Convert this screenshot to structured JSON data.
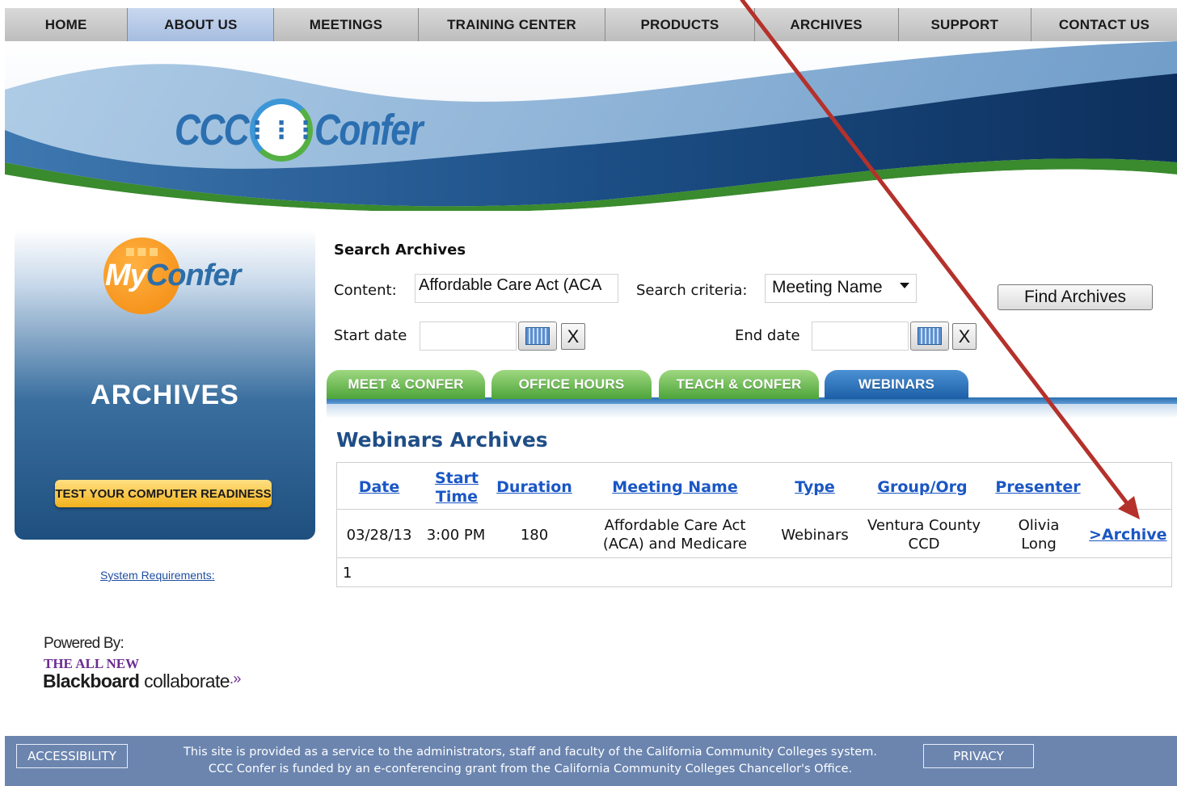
{
  "nav": {
    "items": [
      {
        "label": "HOME"
      },
      {
        "label": "ABOUT US",
        "active": true
      },
      {
        "label": "MEETINGS"
      },
      {
        "label": "TRAINING CENTER"
      },
      {
        "label": "PRODUCTS"
      },
      {
        "label": "ARCHIVES"
      },
      {
        "label": "SUPPORT"
      },
      {
        "label": "CONTACT US"
      }
    ]
  },
  "brand": {
    "logo_left": "CCC",
    "logo_right": "Confer",
    "logo_icon": "phone-keypad-icon"
  },
  "sidebar": {
    "myconfer_my": "My",
    "myconfer_confer": "Confer",
    "heading": "ARCHIVES",
    "readiness_button": "TEST YOUR COMPUTER READINESS",
    "system_requirements": "System Requirements:",
    "powered_by": "Powered By:",
    "all_new": "THE ALL NEW",
    "bb_bold": "Blackboard",
    "bb_rest": "collaborate",
    "bb_mark": ".»"
  },
  "search": {
    "title": "Search Archives",
    "content_label": "Content:",
    "content_value": "Affordable Care Act (ACA",
    "criteria_label": "Search criteria:",
    "criteria_value": "Meeting Name",
    "find_button": "Find Archives",
    "start_label": "Start date",
    "start_value": "",
    "end_label": "End date",
    "end_value": "",
    "clear_label": "X"
  },
  "tabs": [
    {
      "label": "MEET & CONFER",
      "color": "green"
    },
    {
      "label": "OFFICE HOURS",
      "color": "green"
    },
    {
      "label": "TEACH & CONFER",
      "color": "green"
    },
    {
      "label": "WEBINARS",
      "color": "blue",
      "active": true
    }
  ],
  "results": {
    "title": "Webinars Archives",
    "columns": [
      "Date",
      "Start Time",
      "Duration",
      "Meeting Name",
      "Type",
      "Group/Org",
      "Presenter"
    ],
    "rows": [
      {
        "date": "03/28/13",
        "start_time": "3:00 PM",
        "duration": "180",
        "meeting_name_1": "Affordable Care Act",
        "meeting_name_2": "(ACA) and Medicare",
        "type": "Webinars",
        "group_1": "Ventura County",
        "group_2": "CCD",
        "presenter_1": "Olivia",
        "presenter_2": "Long",
        "link": ">Archive"
      }
    ],
    "pager": "1"
  },
  "footer": {
    "accessibility": "ACCESSIBILITY",
    "line1": "This site is provided as a service to the administrators, staff and faculty of the California Community Colleges system.",
    "line2": "CCC Confer is funded by an e-conferencing grant from the California Community Colleges Chancellor's Office.",
    "privacy": "PRIVACY"
  },
  "colors": {
    "link_blue": "#1a56c4",
    "annotation_arrow": "#b5312c",
    "footer_bg": "#6b85af"
  }
}
